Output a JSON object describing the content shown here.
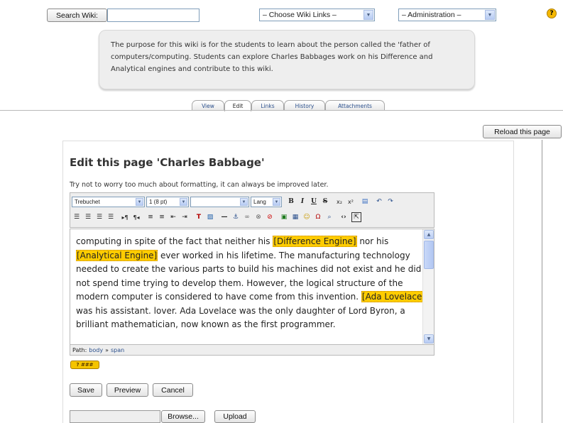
{
  "topbar": {
    "search_button": "Search Wiki:",
    "search_value": "",
    "wiki_links_select": "– Choose Wiki Links –",
    "admin_select": "– Administration –",
    "help_glyph": "?"
  },
  "description": "The purpose for this wiki is for the students to learn about the person called the 'father of computers/computing. Students can explore Charles Babbages work on  his Difference and Analytical engines and contribute to this wiki.",
  "tabs": [
    {
      "label": "View"
    },
    {
      "label": "Edit"
    },
    {
      "label": "Links"
    },
    {
      "label": "History"
    },
    {
      "label": "Attachments"
    }
  ],
  "reload_button": "Reload this page",
  "edit": {
    "title": "Edit this page 'Charles Babbage'",
    "hint": "Try not to worry too much about formatting, it can always be improved later.",
    "toolbar": {
      "font_family": "Trebuchet",
      "font_size": "1 (8 pt)",
      "format": "",
      "lang": "Lang"
    },
    "content": {
      "t1": "computing in spite of the fact that neither his ",
      "l1": "[Difference Engine]",
      "t2": " nor his ",
      "l2": "[Analytical Engine]",
      "t3": " ever worked in his lifetime. The manufacturing technology needed to create the various parts to build his machines did not exist and he did not spend time trying to develop them. However, the logical structure of the modern computer is considered to have come from this invention. ",
      "l3": "[Ada Lovelace]",
      "t4": " was his assistant. lover. Ada Lovelace was the only daughter of Lord Byron, a brilliant mathematician, now known as the first programmer."
    },
    "path": {
      "label": "Path:",
      "body": "body",
      "sep": "»",
      "span": "span"
    },
    "help_badge": "? ###"
  },
  "buttons": {
    "save": "Save",
    "preview": "Preview",
    "cancel": "Cancel",
    "browse": "Browse...",
    "upload": "Upload"
  },
  "file_value": "",
  "colors": {
    "highlight": "#ffcc00",
    "link": "#2a4f8c",
    "help": "#f5b800"
  }
}
